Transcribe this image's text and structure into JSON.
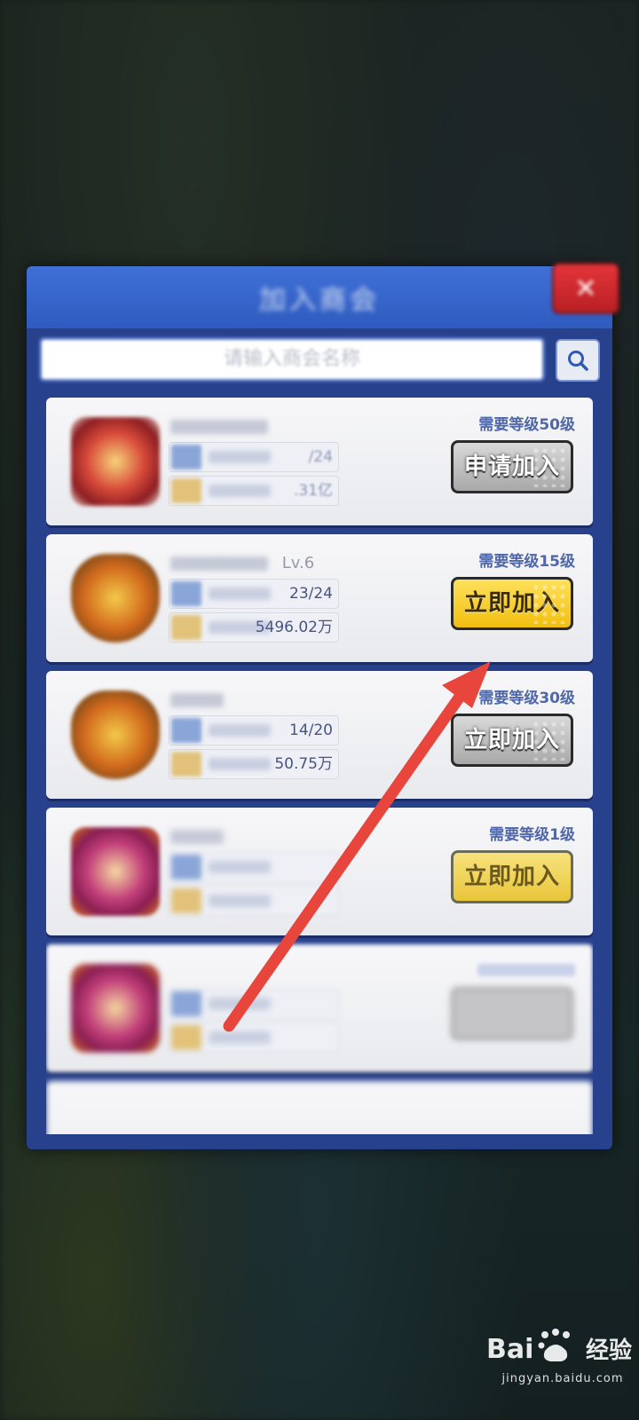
{
  "dialog": {
    "title": "加入商会",
    "close_label": "✕",
    "search_placeholder": "请输入商会名称"
  },
  "cards": [
    {
      "name": "",
      "level": "",
      "members": "/24",
      "assets": ".31亿",
      "requirement": "需要等级50级",
      "button": "申请加入",
      "button_style": "gray"
    },
    {
      "name": "",
      "level": "Lv.6",
      "members": "23/24",
      "assets": "5496.02万",
      "requirement": "需要等级15级",
      "button": "立即加入",
      "button_style": "yellow"
    },
    {
      "name": "",
      "level": "",
      "members": "14/20",
      "assets": "50.75万",
      "requirement": "需要等级30级",
      "button": "立即加入",
      "button_style": "gray"
    },
    {
      "name": "",
      "level": "",
      "members": "",
      "assets": "",
      "requirement": "需要等级1级",
      "button": "立即加入",
      "button_style": "yellow-soft"
    },
    {
      "name": "",
      "level": "",
      "members": "",
      "assets": "",
      "requirement": "",
      "button": "",
      "button_style": "ghost"
    }
  ],
  "watermark": {
    "brand": "Bai du 经验",
    "url": "jingyan.baidu.com"
  },
  "colors": {
    "dialog_frame": "#28418d",
    "header": "#3f70d6",
    "join_yellow": "#f2bf10",
    "join_gray": "#a8a8a8",
    "requirement_text": "#5068a8",
    "annotation_arrow": "#e8453c"
  }
}
